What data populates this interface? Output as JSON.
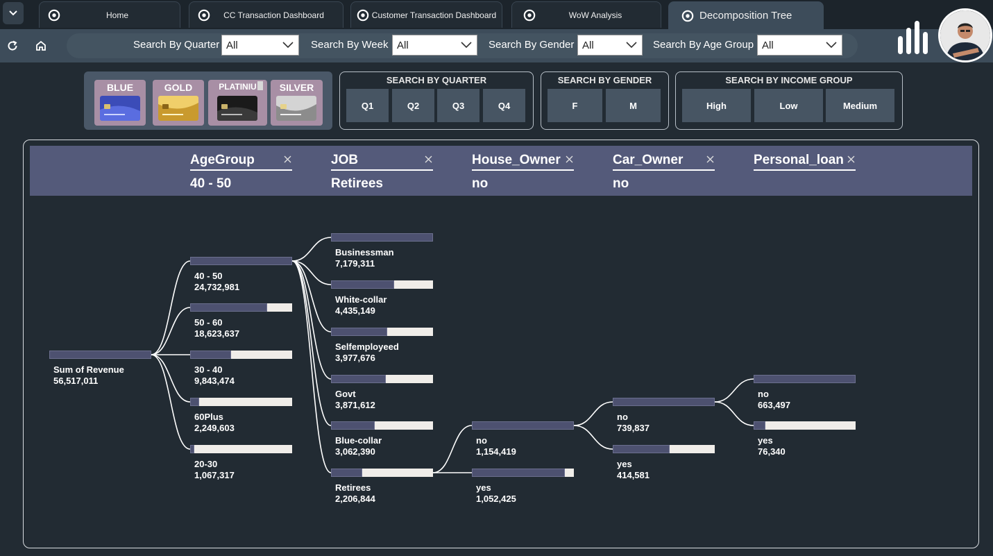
{
  "tabs": [
    {
      "label": "Home"
    },
    {
      "label": "CC Transaction Dashboard"
    },
    {
      "label": "Customer Transaction Dashboard"
    },
    {
      "label": "WoW Analysis"
    },
    {
      "label": "Decomposition Tree"
    }
  ],
  "filters": {
    "quarter": {
      "label": "Search By Quarter",
      "value": "All"
    },
    "week": {
      "label": "Search By Week",
      "value": "All"
    },
    "gender": {
      "label": "Search By Gender",
      "value": "All"
    },
    "age_group": {
      "label": "Search By Age Group",
      "value": "All"
    }
  },
  "cards": [
    {
      "label": "BLUE"
    },
    {
      "label": "GOLD"
    },
    {
      "label": "PLATINIU"
    },
    {
      "label": "SILVER"
    }
  ],
  "slicers": {
    "quarter": {
      "title": "SEARCH BY QUARTER",
      "options": [
        "Q1",
        "Q2",
        "Q3",
        "Q4"
      ]
    },
    "gender": {
      "title": "SEARCH BY GENDER",
      "options": [
        "F",
        "M"
      ]
    },
    "income": {
      "title": "SEARCH BY INCOME GROUP",
      "options": [
        "High",
        "Low",
        "Medium"
      ]
    }
  },
  "tree_header": [
    {
      "title": "AgeGroup",
      "value": "40 - 50"
    },
    {
      "title": "JOB",
      "value": "Retirees"
    },
    {
      "title": "House_Owner",
      "value": "no"
    },
    {
      "title": "Car_Owner",
      "value": "no"
    },
    {
      "title": "Personal_loan",
      "value": ""
    }
  ],
  "tree": {
    "root": {
      "label": "Sum of Revenue",
      "value": "56,517,011",
      "num": 56517011
    },
    "age_group": [
      {
        "label": "40 - 50",
        "value": "24,732,981",
        "num": 24732981
      },
      {
        "label": "50 - 60",
        "value": "18,623,637",
        "num": 18623637
      },
      {
        "label": "30 - 40",
        "value": "9,843,474",
        "num": 9843474
      },
      {
        "label": "60Plus",
        "value": "2,249,603",
        "num": 2249603
      },
      {
        "label": "20-30",
        "value": "1,067,317",
        "num": 1067317
      }
    ],
    "job": [
      {
        "label": "Businessman",
        "value": "7,179,311",
        "num": 7179311
      },
      {
        "label": "White-collar",
        "value": "4,435,149",
        "num": 4435149
      },
      {
        "label": "Selfemployeed",
        "value": "3,977,676",
        "num": 3977676
      },
      {
        "label": "Govt",
        "value": "3,871,612",
        "num": 3871612
      },
      {
        "label": "Blue-collar",
        "value": "3,062,390",
        "num": 3062390
      },
      {
        "label": "Retirees",
        "value": "2,206,844",
        "num": 2206844
      }
    ],
    "house_owner": [
      {
        "label": "no",
        "value": "1,154,419",
        "num": 1154419
      },
      {
        "label": "yes",
        "value": "1,052,425",
        "num": 1052425
      }
    ],
    "car_owner": [
      {
        "label": "no",
        "value": "739,837",
        "num": 739837
      },
      {
        "label": "yes",
        "value": "414,581",
        "num": 414581
      }
    ],
    "personal_loan": [
      {
        "label": "no",
        "value": "663,497",
        "num": 663497
      },
      {
        "label": "yes",
        "value": "76,340",
        "num": 76340
      }
    ]
  },
  "colors": {
    "background": "#222b33",
    "header_band": "#545a7a",
    "bar_fill": "#4d5170",
    "bar_track": "#f0ede9",
    "card_button": "#a88fa5"
  }
}
